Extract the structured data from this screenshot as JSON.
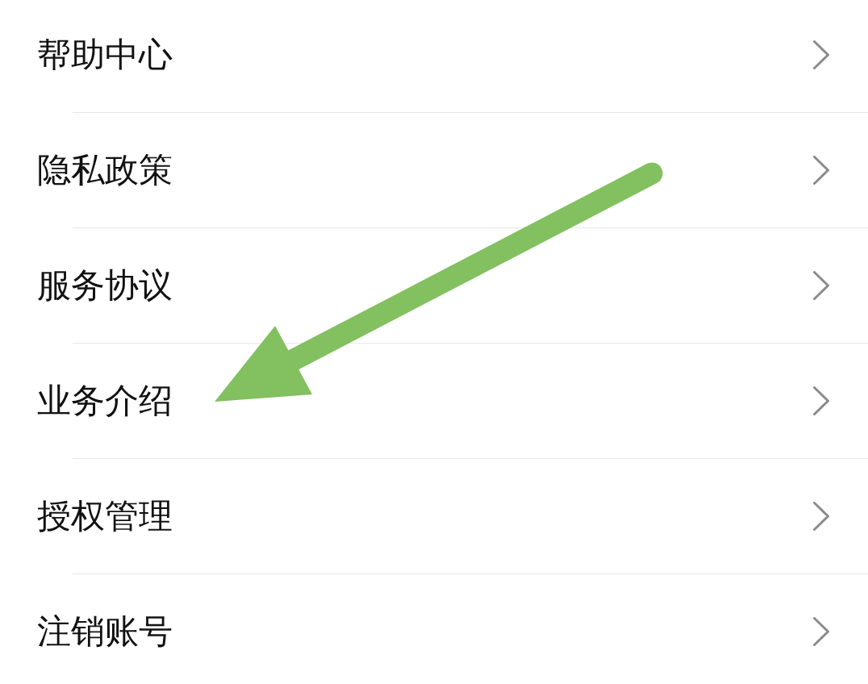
{
  "menu": {
    "items": [
      {
        "label": "帮助中心"
      },
      {
        "label": "隐私政策"
      },
      {
        "label": "服务协议"
      },
      {
        "label": "业务介绍"
      },
      {
        "label": "授权管理"
      },
      {
        "label": "注销账号"
      }
    ]
  }
}
